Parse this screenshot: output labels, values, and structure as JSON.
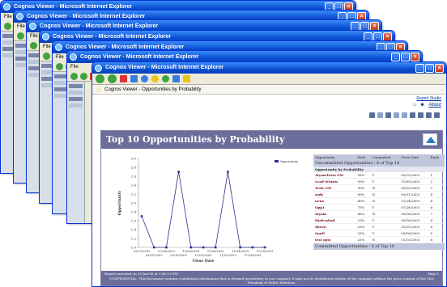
{
  "window_title": "Cognos Viewer - Microsoft Internet Explorer",
  "menu_label": "File",
  "tab_title": "Cognos Viewer - Opportunities by Probability",
  "links": {
    "report_studio": "Report Studio",
    "about": "About"
  },
  "report": {
    "title": "Top 10 Opportunities by Probability",
    "footer_left": "Report executed on 23-Jan-08 at 1:06:11 PM.",
    "footer_right": "Page 1",
    "confidential": "CONFIDENTIAL. This document contains confidential information that is deemed proprietary to our company. It may not be distributed outside of the company without the prior consent of the Vice President of Public Relations."
  },
  "chart_data": {
    "type": "line",
    "xlabel": "Close Date",
    "ylabel": "Opportunity",
    "legend": "Opportunity",
    "legend_position": "top-right",
    "yticks": [
      "1.0",
      "1.2",
      "1.4",
      "1.6",
      "1.8",
      "2.0",
      "2.2",
      "2.4",
      "2.6",
      "2.8",
      "3.0"
    ],
    "ylim": [
      1.0,
      3.0
    ],
    "x_labels_top": [
      "03/15/2003",
      "07/28/2003",
      "10/26/2003",
      "11/09/2003",
      "11/24/2003",
      "11/28/2003"
    ],
    "x_labels_bottom": [
      "03/31/2003",
      "09/16/2003",
      "11/02/2003",
      "11/15/2003",
      "11/24/2003"
    ],
    "values": [
      1.7,
      1.0,
      1.0,
      2.7,
      1.0,
      1.0,
      1.0,
      2.7,
      1.0,
      1.0,
      1.0
    ],
    "colors": {
      "line": "#2b2f8f"
    }
  },
  "table": {
    "headers": [
      "Opportunity",
      "Prob",
      "Committed",
      "Close Date",
      "Rank"
    ],
    "group_label": "Uncommitted Opportunities - 6 of Top 10",
    "sub_label": "Opportunity by Probability",
    "rows": [
      [
        "AtyamTesta OM",
        "99%",
        "Y",
        "03/15/2003",
        "1"
      ],
      [
        "Lead SOunts",
        "99%",
        "Y",
        "11/09/2003",
        "2"
      ],
      [
        "Testt OM",
        "90%",
        "N",
        "03/15/2003",
        "3"
      ],
      [
        "asds",
        "80%",
        "N",
        "03/31/2003",
        "4"
      ],
      [
        "news",
        "80%",
        "N",
        "11/24/2003",
        "4"
      ],
      [
        "Opp1",
        "75%",
        "Y",
        "07/28/2003",
        "6"
      ],
      [
        "Atyam",
        "45%",
        "N",
        "09/16/2003",
        "7"
      ],
      [
        "Hyderabad",
        "25%",
        "Y",
        "09/16/2003",
        "8"
      ],
      [
        "Sheen",
        "25%",
        "Y",
        "11/25/2003",
        "8"
      ],
      [
        "Sunil",
        "25%",
        "Y",
        "09/16/2003",
        "8"
      ],
      [
        "test opty",
        "25%",
        "N",
        "11/15/2003",
        "8"
      ]
    ],
    "foot_label": "Committed Opportunities - 5 of Top 10"
  }
}
